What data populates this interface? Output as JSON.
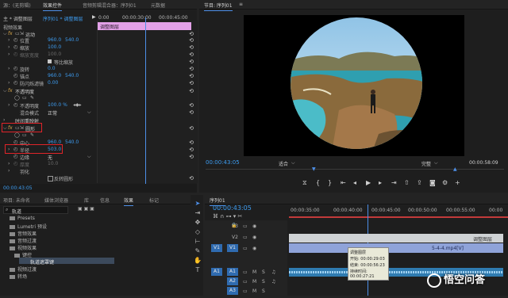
{
  "effect_controls": {
    "tabs": [
      "源：(无剪辑)",
      "效果控件",
      "音频剪辑混合器：序列01",
      "元数据"
    ],
    "clip_label": "主 * 调整图层",
    "sequence_label": "序列01 * 调整图层",
    "ruler_start": "0:00",
    "ruler_mid": "00:00:30:00",
    "ruler_end": "00:00:45:00",
    "adjustment_clip": "调整图层",
    "section_video": "视频效果",
    "motion": "运动",
    "position": "位置",
    "position_x": "960.0",
    "position_y": "540.0",
    "scale": "缩放",
    "scale_value": "100.0",
    "scale_width": "缩放宽度",
    "uniform_scale": "等比缩放",
    "rotation": "旋转",
    "rotation_value": "0.0",
    "anchor": "锚点",
    "anchor_x": "960.0",
    "anchor_y": "540.0",
    "antiflicker": "防闪烁滤镜",
    "antiflicker_value": "0.00",
    "opacity_section": "不透明度",
    "opacity": "不透明度",
    "opacity_value": "100.0 %",
    "blend_mode": "混合模式",
    "blend_mode_value": "正常",
    "time_remap": "时间重映射",
    "circle": "圆形",
    "center": "中心",
    "center_x": "960.0",
    "center_y": "540.0",
    "radius": "半径",
    "radius_value": "503.0",
    "edge": "边缘",
    "edge_value": "无",
    "thickness": "厚度",
    "thickness_value": "10.0",
    "feather": "羽化",
    "invert": "反转圆形",
    "timecode": "00:00:43:05"
  },
  "program_monitor": {
    "title": "节目: 序列01",
    "timecode": "00:00:43:05",
    "fit": "适合",
    "quality": "完整",
    "end_timecode": "00:00:58:09"
  },
  "project_panel": {
    "tabs": [
      "项目: 未命名",
      "媒体浏览器",
      "库",
      "信息",
      "效果",
      "标记"
    ],
    "search_value": "轨道",
    "items": [
      {
        "label": "Presets",
        "indent": 0
      },
      {
        "label": "Lumetri 预设",
        "indent": 0
      },
      {
        "label": "音频效果",
        "indent": 0
      },
      {
        "label": "音频过渡",
        "indent": 0
      },
      {
        "label": "视频效果",
        "indent": 0
      },
      {
        "label": "键控",
        "indent": 1
      },
      {
        "label": "轨道遮罩键",
        "indent": 2
      },
      {
        "label": "视频过渡",
        "indent": 0
      },
      {
        "label": "转场",
        "indent": 0
      }
    ]
  },
  "timeline": {
    "title": "序列01",
    "timecode": "00:00:43:05",
    "ruler": [
      "00:00:35:00",
      "00:00:40:00",
      "00:00:45:00",
      "00:00:50:00",
      "00:00:55:00",
      "00:00"
    ],
    "tracks": [
      "V3",
      "V2",
      "V1",
      "A1",
      "A2",
      "A3"
    ],
    "source_v": "V1",
    "source_a": "A1",
    "clip_v2": "调整图层",
    "clip_v1": "5-4-4.mp4[V]",
    "tooltip": {
      "name": "调整图层",
      "start": "开始: 00:00:29:03",
      "end": "结束: 00:00:56:23",
      "duration": "持续时间: 00:00:27:21"
    }
  },
  "watermark": "悟空问答"
}
